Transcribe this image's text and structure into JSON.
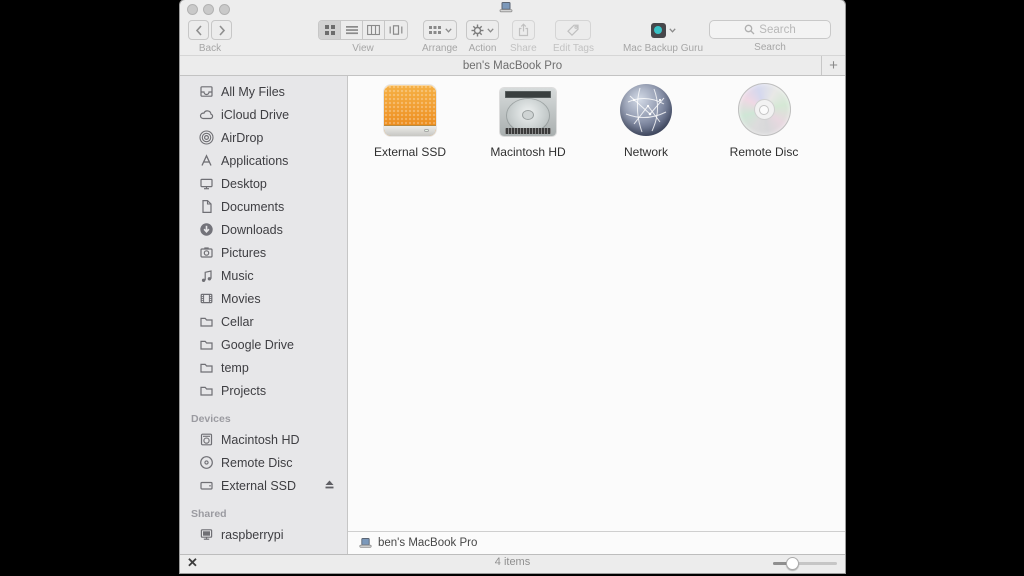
{
  "window": {
    "kind": "finder-window",
    "active": false
  },
  "toolbar": {
    "back_label": "Back",
    "view_label": "View",
    "arrange_label": "Arrange",
    "action_label": "Action",
    "share_label": "Share",
    "edit_tags_label": "Edit Tags",
    "backup_label": "Mac Backup Guru",
    "search_label": "Search",
    "search_placeholder": "Search",
    "view_mode_selected": "icons"
  },
  "tab_bar": {
    "tab_title": "ben's MacBook Pro",
    "new_tab_label": "+"
  },
  "sidebar": {
    "favorites": [
      {
        "label": "All My Files",
        "icon": "all-my-files-icon"
      },
      {
        "label": "iCloud Drive",
        "icon": "icloud-icon"
      },
      {
        "label": "AirDrop",
        "icon": "airdrop-icon"
      },
      {
        "label": "Applications",
        "icon": "applications-icon"
      },
      {
        "label": "Desktop",
        "icon": "desktop-icon"
      },
      {
        "label": "Documents",
        "icon": "documents-icon"
      },
      {
        "label": "Downloads",
        "icon": "downloads-icon"
      },
      {
        "label": "Pictures",
        "icon": "pictures-icon"
      },
      {
        "label": "Music",
        "icon": "music-icon"
      },
      {
        "label": "Movies",
        "icon": "movies-icon"
      },
      {
        "label": "Cellar",
        "icon": "folder-icon"
      },
      {
        "label": "Google Drive",
        "icon": "folder-icon"
      },
      {
        "label": "temp",
        "icon": "folder-icon"
      },
      {
        "label": "Projects",
        "icon": "folder-icon"
      }
    ],
    "devices_header": "Devices",
    "devices": [
      {
        "label": "Macintosh HD",
        "icon": "internal-drive-icon"
      },
      {
        "label": "Remote Disc",
        "icon": "disc-icon"
      },
      {
        "label": "External SSD",
        "icon": "external-drive-icon",
        "ejectable": true
      }
    ],
    "shared_header": "Shared",
    "shared": [
      {
        "label": "raspberrypi",
        "icon": "networked-computer-icon"
      }
    ]
  },
  "main": {
    "view": "icon-grid",
    "items": [
      {
        "label": "External SSD",
        "icon": "external-ssd-volume-icon"
      },
      {
        "label": "Macintosh HD",
        "icon": "internal-hd-volume-icon"
      },
      {
        "label": "Network",
        "icon": "network-globe-icon"
      },
      {
        "label": "Remote Disc",
        "icon": "cd-disc-icon"
      }
    ]
  },
  "path_bar": {
    "location": "ben's MacBook Pro",
    "icon": "laptop-icon"
  },
  "status_bar": {
    "items_count": "4 items"
  },
  "cursor": {
    "glyph": "✕"
  },
  "colors": {
    "chrome": "#ececec",
    "sidebar_bg": "#e7e7e9",
    "main_bg": "#fbfbfb",
    "ssd_orange": "#f09a2e",
    "backup_app_teal": "#39c2c6",
    "inactive_text": "#a6a6a6",
    "desktop_bg": "#000000"
  }
}
